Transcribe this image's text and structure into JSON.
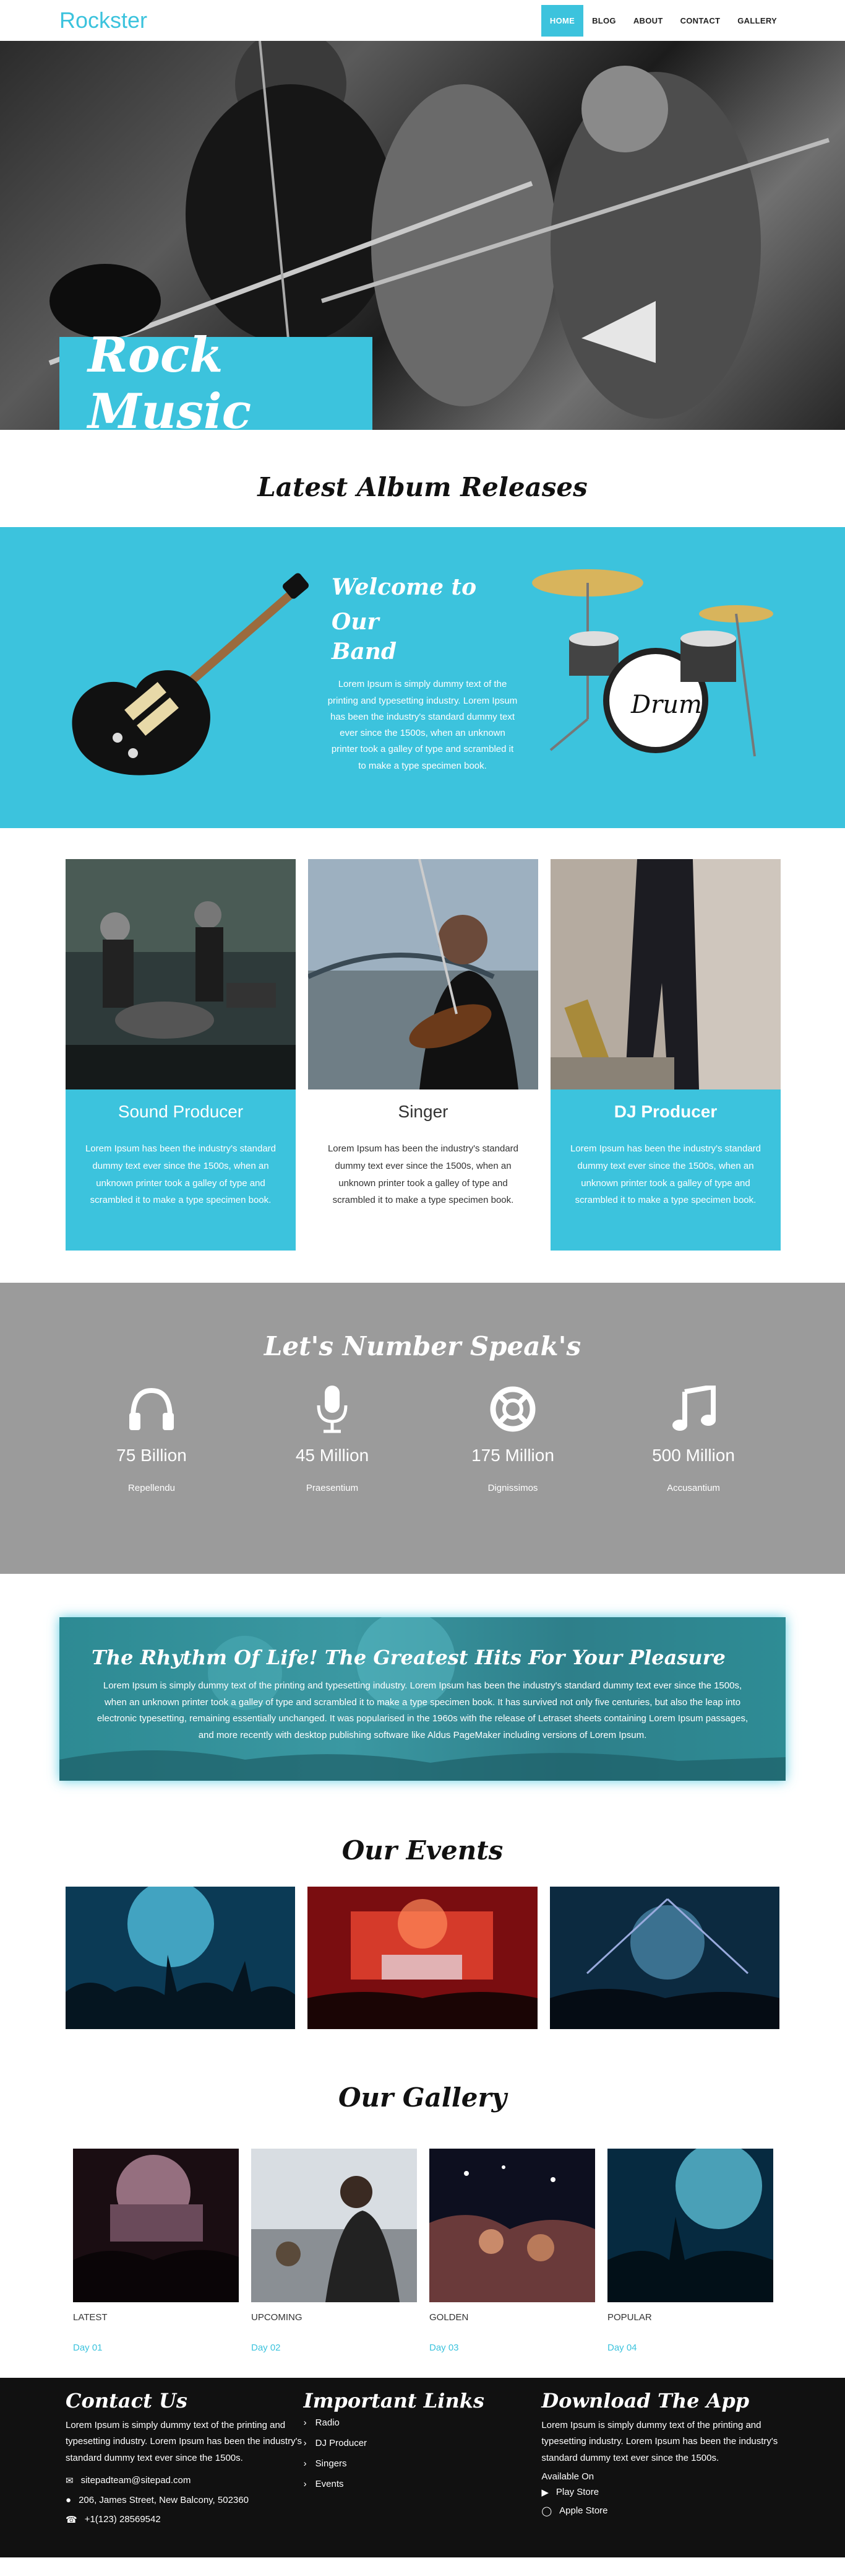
{
  "brand": {
    "name": "Rockster",
    "accent": "#3cc3dd"
  },
  "nav": {
    "items": [
      {
        "label": "HOME",
        "active": true
      },
      {
        "label": "BLOG",
        "active": false
      },
      {
        "label": "ABOUT",
        "active": false
      },
      {
        "label": "CONTACT",
        "active": false
      },
      {
        "label": "GALLERY",
        "active": false
      }
    ]
  },
  "hero": {
    "title": "Rock Music"
  },
  "albums": {
    "title": "Latest Album Releases"
  },
  "welcome": {
    "title_line1": "Welcome to Our",
    "title_line2": "Band",
    "body": "Lorem Ipsum is simply dummy text of the printing and typesetting industry. Lorem Ipsum has been the industry's standard dummy text ever since the 1500s, when an unknown printer took a galley of type and scrambled it to make a type specimen book."
  },
  "services": [
    {
      "title": "Sound Producer",
      "body": "Lorem Ipsum has been the industry's standard dummy text ever since the 1500s, when an unknown printer took a galley of type and scrambled it to make a type specimen book."
    },
    {
      "title": "Singer",
      "body": "Lorem Ipsum has been the industry's standard dummy text ever since the 1500s, when an unknown printer took a galley of type and scrambled it to make a type specimen book."
    },
    {
      "title": "DJ Producer",
      "body": "Lorem Ipsum has been the industry's standard dummy text ever since the 1500s, when an unknown printer took a galley of type and scrambled it to make a type specimen book."
    }
  ],
  "numbers": {
    "title": "Let's Number Speak's",
    "items": [
      {
        "icon": "headphones-icon",
        "value": "75 Billion",
        "label": "Repellendu"
      },
      {
        "icon": "microphone-icon",
        "value": "45 Million",
        "label": "Praesentium"
      },
      {
        "icon": "lifebuoy-icon",
        "value": "175 Million",
        "label": "Dignissimos"
      },
      {
        "icon": "music-note-icon",
        "value": "500 Million",
        "label": "Accusantium"
      }
    ]
  },
  "rhythm": {
    "title": "The Rhythm Of Life! The Greatest Hits For Your Pleasure",
    "body": "Lorem Ipsum is simply dummy text of the printing and typesetting industry. Lorem Ipsum has been the industry's standard dummy text ever since the 1500s, when an unknown printer took a galley of type and scrambled it to make a type specimen book. It has survived not only five centuries, but also the leap into electronic typesetting, remaining essentially unchanged. It was popularised in the 1960s with the release of Letraset sheets containing Lorem Ipsum passages, and more recently with desktop publishing software like Aldus PageMaker including versions of Lorem Ipsum."
  },
  "events": {
    "title": "Our Events"
  },
  "gallery": {
    "title": "Our Gallery",
    "items": [
      {
        "caption": "LATEST",
        "day": "Day 01"
      },
      {
        "caption": "UPCOMING",
        "day": "Day 02"
      },
      {
        "caption": "GOLDEN",
        "day": "Day 03"
      },
      {
        "caption": "POPULAR",
        "day": "Day 04"
      }
    ]
  },
  "footer": {
    "contact": {
      "title": "Contact Us",
      "body": "Lorem Ipsum is simply dummy text of the printing and typesetting industry. Lorem Ipsum has been the industry's standard dummy text ever since the 1500s.",
      "email": "sitepadteam@sitepad.com",
      "address": "206, James Street, New Balcony, 502360",
      "phone": "+1(123) 28569542"
    },
    "links": {
      "title": "Important Links",
      "items": [
        "Radio",
        "DJ Producer",
        "Singers",
        "Events"
      ]
    },
    "app": {
      "title": "Download The App",
      "body": "Lorem Ipsum is simply dummy text of the printing and typesetting industry. Lorem Ipsum has been the industry's standard dummy text ever since the 1500s.",
      "available": "Available On",
      "play": "Play Store",
      "apple": "Apple Store"
    }
  }
}
